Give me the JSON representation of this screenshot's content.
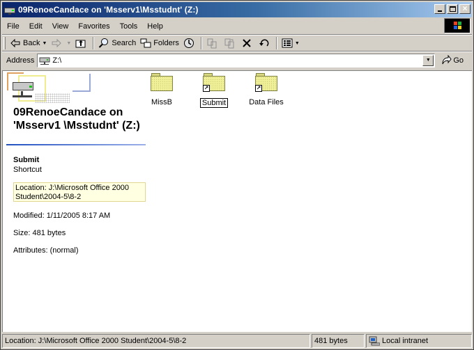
{
  "window": {
    "title": "09RenoeCandace on 'Msserv1\\Msstudnt' (Z:)"
  },
  "menu": {
    "items": [
      "File",
      "Edit",
      "View",
      "Favorites",
      "Tools",
      "Help"
    ]
  },
  "toolbar": {
    "back_label": "Back",
    "search_label": "Search",
    "folders_label": "Folders"
  },
  "address": {
    "label": "Address",
    "value": "Z:\\",
    "go_label": "Go"
  },
  "info_pane": {
    "drive_title": "09RenoeCandace on 'Msserv1 \\Msstudnt' (Z:)",
    "selected_name": "Submit",
    "selected_type": "Shortcut",
    "location": "Location: J:\\Microsoft Office 2000 Student\\2004-5\\8-2",
    "modified": "Modified: 1/11/2005 8:17 AM",
    "size": "Size: 481 bytes",
    "attributes": "Attributes: (normal)"
  },
  "items": [
    {
      "label": "MissB",
      "shortcut": false
    },
    {
      "label": "Submit",
      "shortcut": true,
      "renaming": true
    },
    {
      "label": "Data Files",
      "shortcut": true
    }
  ],
  "statusbar": {
    "location": "Location: J:\\Microsoft Office 2000 Student\\2004-5\\8-2",
    "size": "481 bytes",
    "zone": "Local intranet"
  },
  "colors": {
    "titlebar_start": "#0a246a",
    "titlebar_end": "#a6caf0",
    "chrome": "#d4d0c8",
    "info_tip": "#ffffe1"
  }
}
